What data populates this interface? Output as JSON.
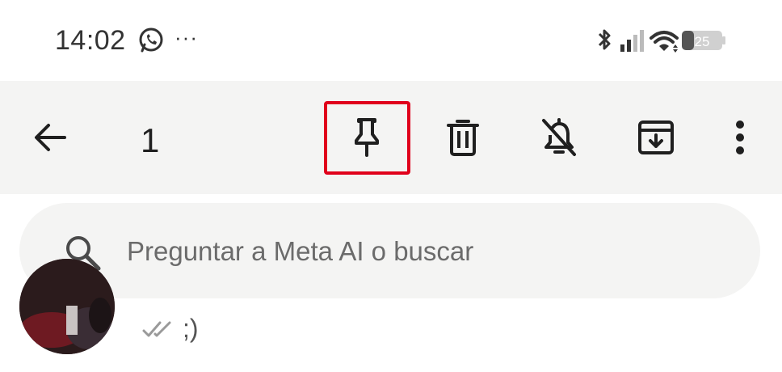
{
  "status_bar": {
    "time": "14:02",
    "dots": "···",
    "battery_level": "25"
  },
  "toolbar": {
    "selected_count": "1"
  },
  "search": {
    "placeholder": "Preguntar a Meta AI o buscar"
  },
  "chat": {
    "preview_text": ";)"
  },
  "colors": {
    "toolbar_bg": "#f4f4f3",
    "highlight": "#e0001b",
    "icon": "#1f1f1f"
  }
}
